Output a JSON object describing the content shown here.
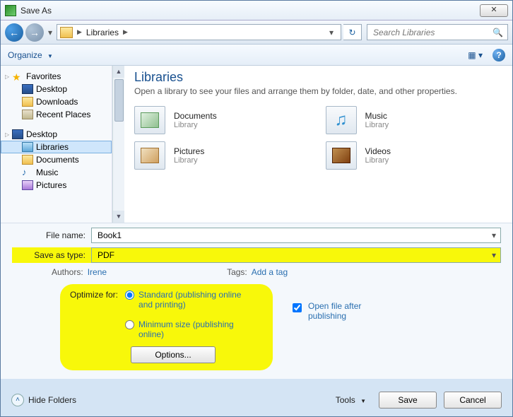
{
  "title": "Save As",
  "nav": {
    "location_root": "Libraries",
    "search_placeholder": "Search Libraries"
  },
  "toolbar": {
    "organize": "Organize"
  },
  "sidebar": {
    "favorites": "Favorites",
    "fav_items": [
      "Desktop",
      "Downloads",
      "Recent Places"
    ],
    "desktop": "Desktop",
    "libraries": "Libraries",
    "lib_items": [
      "Documents",
      "Music",
      "Pictures"
    ]
  },
  "main": {
    "heading": "Libraries",
    "sub": "Open a library to see your files and arrange them by folder, date, and other properties.",
    "libs": [
      {
        "name": "Documents",
        "sub": "Library"
      },
      {
        "name": "Music",
        "sub": "Library"
      },
      {
        "name": "Pictures",
        "sub": "Library"
      },
      {
        "name": "Videos",
        "sub": "Library"
      }
    ]
  },
  "fields": {
    "filename_label": "File name:",
    "filename_value": "Book1",
    "saveastype_label": "Save as type:",
    "saveastype_value": "PDF",
    "authors_label": "Authors:",
    "authors_value": "Irene",
    "tags_label": "Tags:",
    "tags_value": "Add a tag",
    "optimize_label": "Optimize for:",
    "opt_standard": "Standard (publishing online and printing)",
    "opt_minimum": "Minimum size (publishing online)",
    "options_btn": "Options...",
    "openafter": "Open file after publishing"
  },
  "buttons": {
    "hide": "Hide Folders",
    "tools": "Tools",
    "save": "Save",
    "cancel": "Cancel"
  }
}
